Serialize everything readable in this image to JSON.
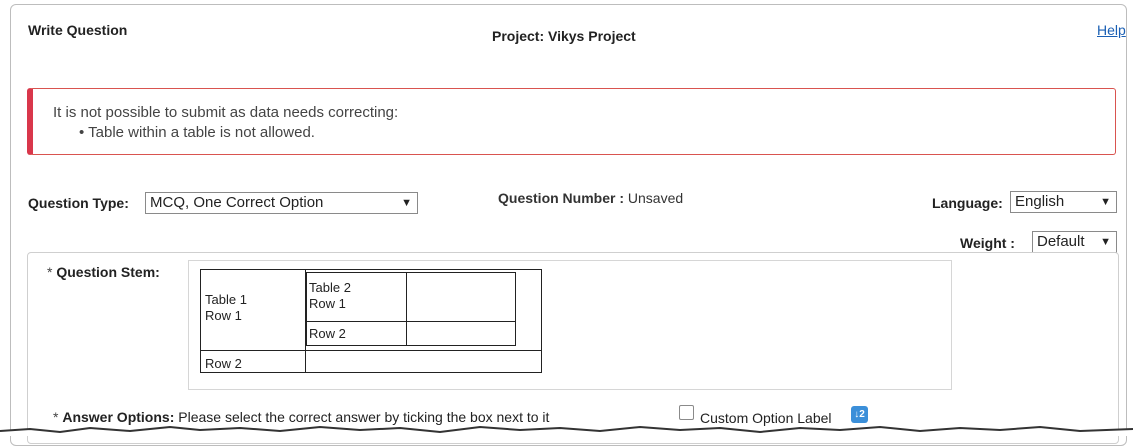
{
  "header": {
    "title": "Write Question",
    "project": "Project: Vikys Project",
    "help_label": "Help"
  },
  "alert": {
    "message": "It is not possible to submit as data needs correcting:",
    "errors": [
      "Table within a table is not allowed."
    ],
    "color": "#d9374b"
  },
  "form": {
    "question_type_label": "Question Type:",
    "question_type_value": "MCQ, One Correct Option",
    "question_number_label": "Question Number :",
    "question_number_value": "Unsaved",
    "language_label": "Language:",
    "language_value": "English",
    "weight_label": "Weight :",
    "weight_value": "Default"
  },
  "stem": {
    "required_mark": "*",
    "label": "Question Stem:",
    "table": {
      "outer_row1": "Table 1\nRow 1",
      "outer_row2": "Row 2",
      "inner_row1": "Table 2\nRow 1",
      "inner_row2": "Row 2"
    }
  },
  "answers": {
    "required_mark": "*",
    "label": "Answer Options:",
    "instruction": "Please select the correct answer by ticking the box next to it",
    "custom_option_label": "Custom Option Label",
    "custom_option_checked": false,
    "sort_icon": "sort-numeric-icon"
  },
  "colors": {
    "link": "#1a5fb4",
    "alert_border": "#d9374b",
    "icon_blue": "#3b8fd9"
  }
}
